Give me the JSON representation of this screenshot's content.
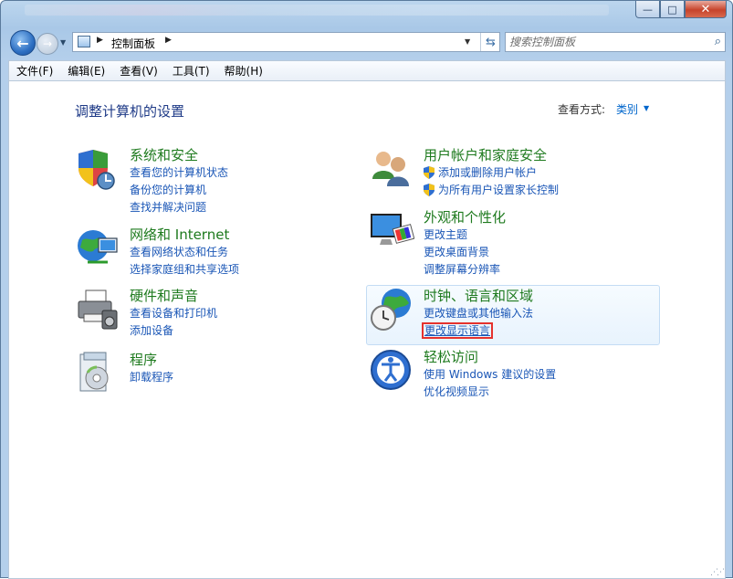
{
  "window": {
    "caption_buttons": {
      "minimize": "—",
      "maximize": "□",
      "close": "✕"
    }
  },
  "nav": {
    "back_glyph": "←",
    "forward_glyph": "→",
    "history_glyph": "▼",
    "breadcrumb": "控制面板",
    "sep": "▶",
    "dropdown_glyph": "▼",
    "refresh_glyph": "⇆",
    "search_placeholder": "搜索控制面板",
    "search_glyph": "⌕"
  },
  "menu": [
    "文件(F)",
    "编辑(E)",
    "查看(V)",
    "工具(T)",
    "帮助(H)"
  ],
  "main": {
    "title": "调整计算机的设置",
    "view_label": "查看方式:",
    "view_value": "类别",
    "view_caret": "▼"
  },
  "categories_left": [
    {
      "title": "系统和安全",
      "icon": "shield-icon",
      "links": [
        "查看您的计算机状态",
        "备份您的计算机",
        "查找并解决问题"
      ]
    },
    {
      "title": "网络和 Internet",
      "icon": "network-globe-icon",
      "links": [
        "查看网络状态和任务",
        "选择家庭组和共享选项"
      ]
    },
    {
      "title": "硬件和声音",
      "icon": "printer-icon",
      "links": [
        "查看设备和打印机",
        "添加设备"
      ]
    },
    {
      "title": "程序",
      "icon": "programs-disc-icon",
      "links": [
        "卸载程序"
      ]
    }
  ],
  "categories_right": [
    {
      "title": "用户帐户和家庭安全",
      "icon": "users-icon",
      "links": [
        "添加或删除用户帐户",
        "为所有用户设置家长控制"
      ]
    },
    {
      "title": "外观和个性化",
      "icon": "monitor-palette-icon",
      "links": [
        "更改主题",
        "更改桌面背景",
        "调整屏幕分辨率"
      ]
    },
    {
      "title": "时钟、语言和区域",
      "icon": "clock-globe-icon",
      "links": [
        "更改键盘或其他输入法",
        "更改显示语言"
      ]
    },
    {
      "title": "轻松访问",
      "icon": "ease-of-access-icon",
      "links": [
        "使用 Windows 建议的设置",
        "优化视频显示"
      ]
    }
  ],
  "colors": {
    "category_title": "#1e7a1e",
    "link": "#1a56b6",
    "page_title": "#1e3a87",
    "highlight": "#e5322d"
  }
}
